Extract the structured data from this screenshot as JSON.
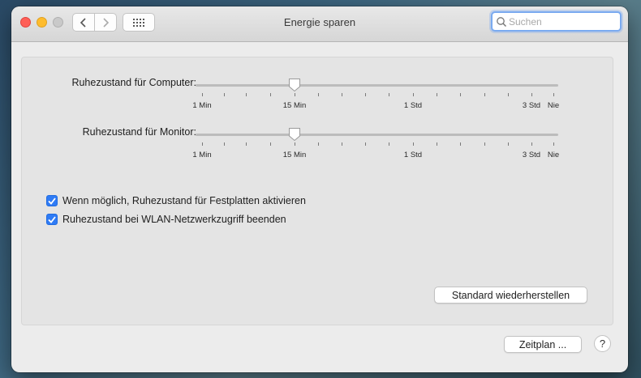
{
  "window": {
    "title": "Energie sparen"
  },
  "search": {
    "placeholder": "Suchen",
    "value": ""
  },
  "sliders": [
    {
      "label": "Ruhezustand für Computer:",
      "value_label": "15 Min",
      "tick_labels": [
        "1 Min",
        "15 Min",
        "1 Std",
        "3 Std",
        "Nie"
      ]
    },
    {
      "label": "Ruhezustand für Monitor:",
      "value_label": "15 Min",
      "tick_labels": [
        "1 Min",
        "15 Min",
        "1 Std",
        "3 Std",
        "Nie"
      ]
    }
  ],
  "checkboxes": [
    {
      "label": "Wenn möglich, Ruhezustand für Festplatten aktivieren",
      "checked": true
    },
    {
      "label": "Ruhezustand bei WLAN-Netzwerkzugriff beenden",
      "checked": true
    }
  ],
  "buttons": {
    "restore_defaults": "Standard wiederherstellen",
    "schedule": "Zeitplan ...",
    "help": "?"
  },
  "icons": {
    "back": "chevron-left-icon",
    "forward": "chevron-right-icon",
    "grid": "grid-icon",
    "search": "magnifier-icon",
    "check": "checkmark-icon"
  },
  "colors": {
    "accent": "#2f7bf5",
    "close": "#fe5f57",
    "minimize": "#febc2e"
  }
}
